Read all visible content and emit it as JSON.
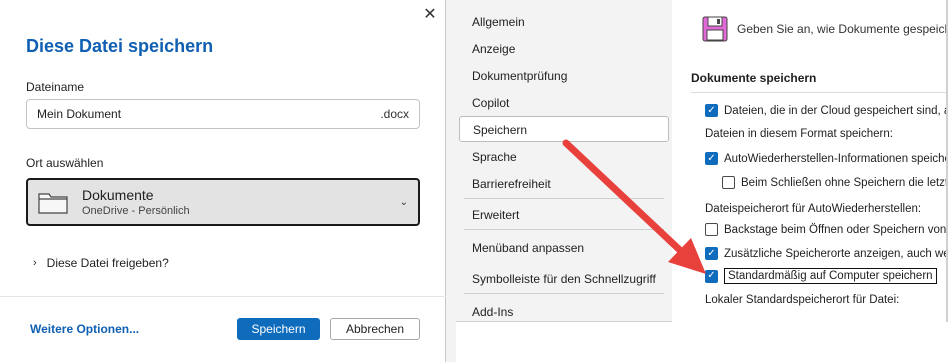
{
  "dialog": {
    "title": "Diese Datei speichern",
    "filename_label": "Dateiname",
    "filename_value": "Mein Dokument",
    "extension": ".docx",
    "location_label": "Ort auswählen",
    "location_main": "Dokumente",
    "location_sub": "OneDrive - Persönlich",
    "share_label": "Diese Datei freigeben?",
    "more_options": "Weitere Optionen...",
    "save_button": "Speichern",
    "cancel_button": "Abbrechen",
    "close_glyph": "✕",
    "chevron_down": "⌄",
    "chevron_right": "›"
  },
  "nav": {
    "items": [
      {
        "label": "Allgemein"
      },
      {
        "label": "Anzeige"
      },
      {
        "label": "Dokumentprüfung"
      },
      {
        "label": "Copilot"
      },
      {
        "label": "Speichern"
      },
      {
        "label": "Sprache"
      },
      {
        "label": "Barrierefreiheit"
      },
      {
        "label": "Erweitert"
      },
      {
        "label": "Menüband anpassen"
      },
      {
        "label": "Symbolleiste für den Schnellzugriff"
      },
      {
        "label": "Add-Ins"
      }
    ],
    "active": "Speichern"
  },
  "pane": {
    "header_text": "Geben Sie an, wie Dokumente gespeichert werden sollen.",
    "section_title": "Dokumente speichern",
    "opt_cloud": "Dateien, die in der Cloud gespeichert sind, automatisch speichern",
    "format_label": "Dateien in diesem Format speichern:",
    "opt_autorecover": "AutoWiederherstellen-Informationen speichern alle",
    "opt_keep_last": "Beim Schließen ohne Speichern die letzte Version behalten",
    "autorecover_location_label": "Dateispeicherort für AutoWiederherstellen:",
    "opt_backstage": "Backstage beim Öffnen oder Speichern von Dateien nicht anzeigen",
    "opt_additional": "Zusätzliche Speicherorte anzeigen, auch wenn eine Anmeldung erforderlich ist",
    "opt_default_computer": "Standardmäßig auf Computer speichern",
    "local_default_label": "Lokaler Standardspeicherort für Datei:",
    "checkmark": "✓"
  },
  "colors": {
    "accent": "#0f6cbd",
    "title_blue": "#0f5fb3",
    "arrow_red": "#e8413c"
  },
  "icons": [
    "close-icon",
    "folder-icon",
    "chevron-down-icon",
    "chevron-right-icon",
    "floppy-disk-icon",
    "checkbox-icon",
    "arrow-annotation"
  ]
}
